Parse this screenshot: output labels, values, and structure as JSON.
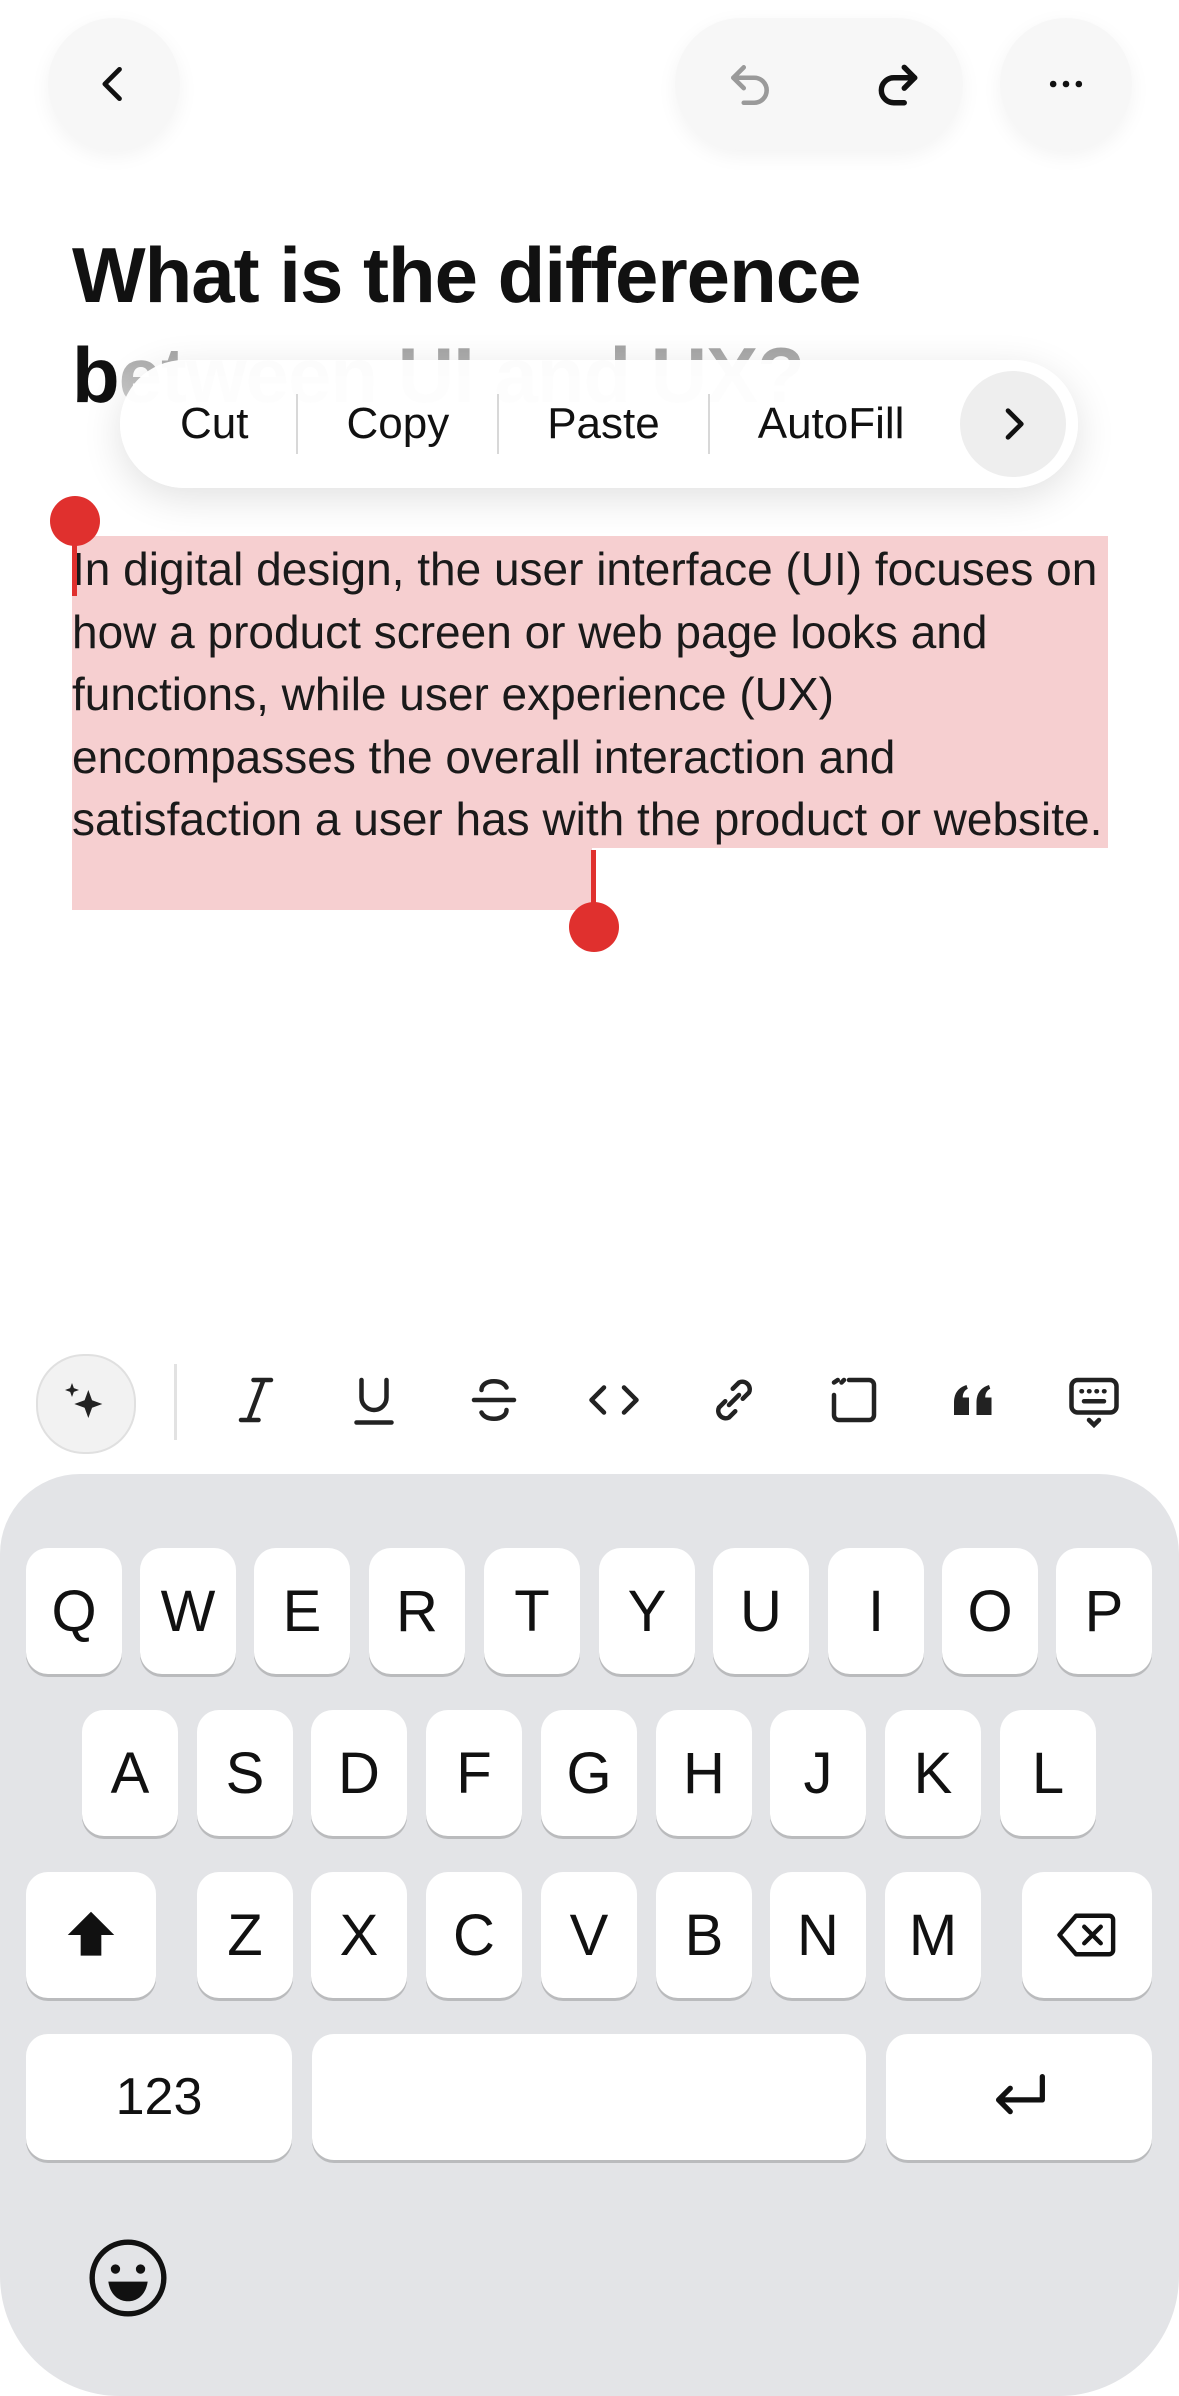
{
  "header": {
    "back_icon": "chevron-left-icon",
    "undo_icon": "undo-icon",
    "redo_icon": "redo-icon",
    "more_icon": "more-horizontal-icon"
  },
  "document": {
    "title": "What is the difference between UI and UX?",
    "body": "In digital design, the user interface (UI) focuses on how a product screen or web page looks and functions, while user experience (UX) encompasses the overall interaction and satisfaction a user has with the product or website."
  },
  "context_menu": {
    "items": [
      "Cut",
      "Copy",
      "Paste",
      "AutoFill"
    ],
    "more_icon": "chevron-right-icon"
  },
  "selection": {
    "highlight_color": "#f6cfd0",
    "handle_color": "#e0302e"
  },
  "format_toolbar": {
    "tools": [
      "ai-sparkle-icon",
      "italic-icon",
      "underline-icon",
      "strikethrough-icon",
      "code-icon",
      "link-icon",
      "code-block-icon",
      "quote-icon",
      "keyboard-dismiss-icon"
    ]
  },
  "keyboard": {
    "row1": [
      "Q",
      "W",
      "E",
      "R",
      "T",
      "Y",
      "U",
      "I",
      "O",
      "P"
    ],
    "row2": [
      "A",
      "S",
      "D",
      "F",
      "G",
      "H",
      "J",
      "K",
      "L"
    ],
    "row3": [
      "Z",
      "X",
      "C",
      "V",
      "B",
      "N",
      "M"
    ],
    "numbers_label": "123",
    "space_label": "",
    "shift_icon": "shift-icon",
    "delete_icon": "backspace-icon",
    "return_icon": "return-icon",
    "emoji_icon": "emoji-icon"
  }
}
